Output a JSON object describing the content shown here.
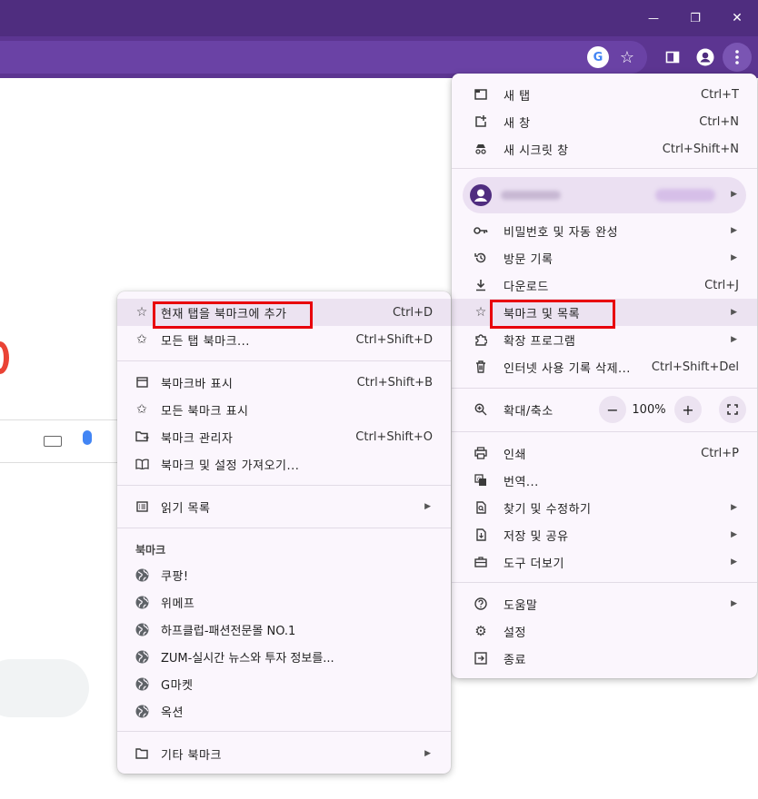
{
  "window": {
    "minimize": "—",
    "restore": "❐",
    "close": "✕"
  },
  "toolbar": {
    "google_icon": "G",
    "star": "☆"
  },
  "main_menu": {
    "items": [
      {
        "label": "새 탭",
        "shortcut": "Ctrl+T"
      },
      {
        "label": "새 창",
        "shortcut": "Ctrl+N"
      },
      {
        "label": "새 시크릿 창",
        "shortcut": "Ctrl+Shift+N"
      },
      {
        "label": "비밀번호 및 자동 완성"
      },
      {
        "label": "방문 기록"
      },
      {
        "label": "다운로드",
        "shortcut": "Ctrl+J"
      },
      {
        "label": "북마크 및 목록"
      },
      {
        "label": "확장 프로그램"
      },
      {
        "label": "인터넷 사용 기록 삭제...",
        "shortcut": "Ctrl+Shift+Del"
      },
      {
        "label": "확대/축소"
      },
      {
        "label": "인쇄",
        "shortcut": "Ctrl+P"
      },
      {
        "label": "번역..."
      },
      {
        "label": "찾기 및 수정하기"
      },
      {
        "label": "저장 및 공유"
      },
      {
        "label": "도구 더보기"
      },
      {
        "label": "도움말"
      },
      {
        "label": "설정"
      },
      {
        "label": "종료"
      }
    ],
    "zoom": {
      "minus": "−",
      "value": "100%",
      "plus": "+"
    }
  },
  "bookmark_menu": {
    "items": [
      {
        "label": "현재 탭을 북마크에 추가",
        "shortcut": "Ctrl+D"
      },
      {
        "label": "모든 탭 북마크...",
        "shortcut": "Ctrl+Shift+D"
      },
      {
        "label": "북마크바 표시",
        "shortcut": "Ctrl+Shift+B"
      },
      {
        "label": "모든 북마크 표시"
      },
      {
        "label": "북마크 관리자",
        "shortcut": "Ctrl+Shift+O"
      },
      {
        "label": "북마크 및 설정 가져오기..."
      },
      {
        "label": "읽기 목록"
      }
    ],
    "section_title": "북마크",
    "bookmarks": [
      {
        "label": "쿠팡!"
      },
      {
        "label": "위메프"
      },
      {
        "label": "하프클럽-패션전문몰 NO.1"
      },
      {
        "label": "ZUM-실시간 뉴스와 투자 정보를..."
      },
      {
        "label": "G마켓"
      },
      {
        "label": "옥션"
      }
    ],
    "other": "기타 북마크"
  },
  "colors": {
    "titlebar": "#4f2d7f",
    "toolbar": "#5c3591",
    "menu_bg": "#fbf6fd",
    "highlight": "#ece3f1",
    "annotation": "#e8000b"
  }
}
